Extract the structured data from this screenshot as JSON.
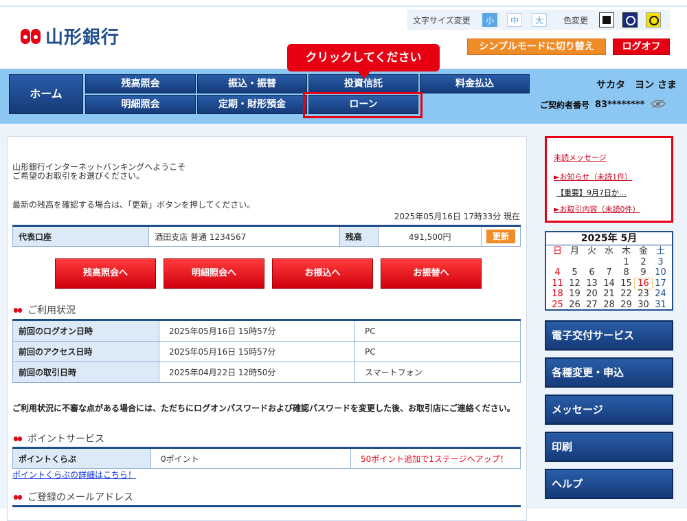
{
  "header": {
    "bank_name": "山形銀行",
    "font_size_label": "文字サイズ変更",
    "font_sizes": [
      "小",
      "中",
      "大"
    ],
    "color_label": "色変更",
    "simple_mode": "シンプルモードに切り替え",
    "logout": "ログオフ"
  },
  "tooltip": "クリックしてください",
  "nav": {
    "home": "ホーム",
    "row1": [
      "残高照会",
      "振込・振替",
      "投資信託",
      "料金払込"
    ],
    "row2": [
      "明細照会",
      "定期・財形預金",
      "ローン"
    ],
    "user_name": "サカタ　ヨン さま",
    "contract_label": "ご契約者番号",
    "contract_number": "83********"
  },
  "main": {
    "welcome1": "山形銀行インターネットバンキングへようこそ",
    "welcome2": "ご希望のお取引をお選びください。",
    "refresh_note": "最新の残高を確認する場合は、「更新」ボタンを押してください。",
    "timestamp": "2025年05月16日 17時33分 現在",
    "account": {
      "label": "代表口座",
      "branch": "酒田支店 普通 1234567",
      "balance_label": "残高",
      "balance": "491,500円",
      "refresh": "更新"
    },
    "action_buttons": [
      "残高照会へ",
      "明細照会へ",
      "お振込へ",
      "お振替へ"
    ],
    "usage_title": "ご利用状況",
    "usage_rows": [
      {
        "label": "前回のログオン日時",
        "datetime": "2025年05月16日 15時57分",
        "device": "PC"
      },
      {
        "label": "前回のアクセス日時",
        "datetime": "2025年05月16日 15時57分",
        "device": "PC"
      },
      {
        "label": "前回の取引日時",
        "datetime": "2025年04月22日 12時50分",
        "device": "スマートフォン"
      }
    ],
    "warning": "ご利用状況に不審な点がある場合には、ただちにログオンパスワードおよび確認パスワードを変更した後、お取引店にご連絡ください。",
    "points_title": "ポイントサービス",
    "points": {
      "label": "ポイントくらぶ",
      "value": "0ポイント",
      "promo": "50ポイント追加で1ステージへアップ！"
    },
    "points_link": "ポイントくらぶの詳細はこちら！",
    "email_title": "ご登録のメールアドレス"
  },
  "messages": {
    "unread": "未読メッセージ",
    "notice": "►お知らせ（未読1件）",
    "notice_item": "【重要】9月7日か…",
    "transactions": "►お取引内容（未読0件）"
  },
  "calendar": {
    "title": "2025年 5月",
    "weekdays": [
      "日",
      "月",
      "火",
      "水",
      "木",
      "金",
      "土"
    ],
    "days": [
      "",
      "",
      "",
      "",
      "1",
      "2",
      "3",
      "4",
      "5",
      "6",
      "7",
      "8",
      "9",
      "10",
      "11",
      "12",
      "13",
      "14",
      "15",
      "16",
      "17",
      "18",
      "19",
      "20",
      "21",
      "22",
      "23",
      "24",
      "25",
      "26",
      "27",
      "28",
      "29",
      "30",
      "31"
    ],
    "today": "16"
  },
  "side_menu": [
    "電子交付サービス",
    "各種変更・申込",
    "メッセージ",
    "印刷",
    "ヘルプ"
  ],
  "colors": {
    "accent_red": "#e60012",
    "navy": "#1f4e8c",
    "nav_band": "#8cc6f2",
    "orange": "#f08c28"
  }
}
